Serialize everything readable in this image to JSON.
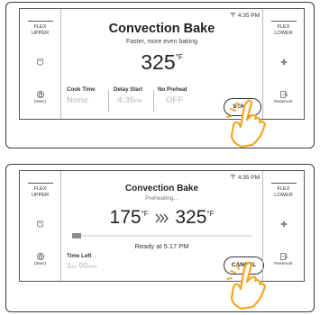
{
  "top_panel": {
    "status_time": "4:35 PM",
    "left_side": {
      "label_line1": "FLEX",
      "label_line2": "UPPER",
      "sub_label": "(3sec)"
    },
    "right_side": {
      "label_line1": "FLEX",
      "label_line2": "LOWER",
      "sub_label": "Reservoir"
    },
    "title": "Convection Bake",
    "subtitle": "Faster, more even baking",
    "temperature": "325",
    "temp_unit": "°F",
    "options": [
      {
        "label": "Cook Time",
        "value": "None",
        "unit": ""
      },
      {
        "label": "Delay Start",
        "value": "4:35",
        "unit": "PM"
      },
      {
        "label": "No Preheat",
        "value": "OFF",
        "unit": ""
      }
    ],
    "start_button": "START"
  },
  "bottom_panel": {
    "status_time": "4:35 PM",
    "left_side": {
      "label_line1": "FLEX",
      "label_line2": "UPPER",
      "sub_label": "(3sec)"
    },
    "right_side": {
      "label_line1": "FLEX",
      "label_line2": "LOWER",
      "sub_label": "Reservoir"
    },
    "title": "Convection Bake",
    "subtitle": "Preheating...",
    "current_temp": "175",
    "target_temp": "325",
    "temp_unit": "°F",
    "progress_fraction": 0.05,
    "ready_text": "Ready at 5:17 PM",
    "time_left_label": "Time Left",
    "time_left_hours": "1",
    "time_left_hours_unit": "hr",
    "time_left_minutes": "00",
    "time_left_minutes_unit": "min",
    "cancel_button": "CANCEL"
  },
  "icons": {
    "timer": "timer-icon",
    "lock": "lock-icon",
    "fan": "fan-icon",
    "reservoir": "reservoir-icon",
    "wifi": "wifi-icon",
    "arrows": "double-arrow-icon",
    "hand": "hand-pointer-icon"
  },
  "colors": {
    "hand": "#f5a623",
    "progress": "#8d8d8d",
    "disabled_text": "#cccccc"
  }
}
